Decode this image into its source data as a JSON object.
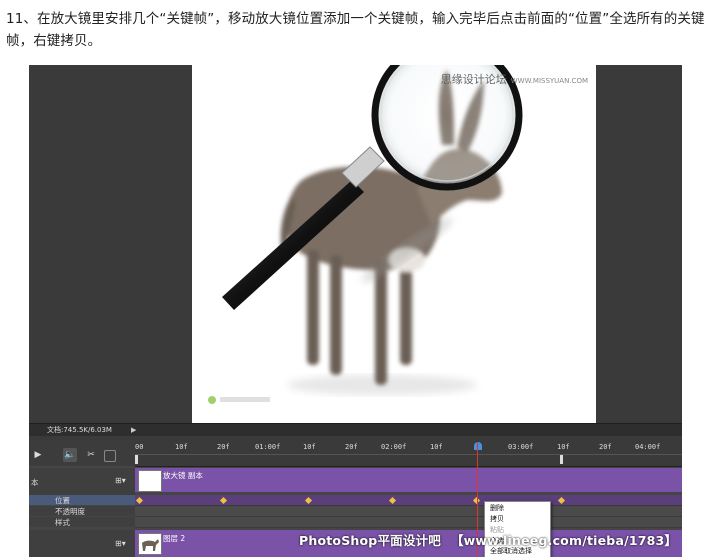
{
  "instruction": "11、在放大镜里安排几个“关键帧”，移动放大镜位置添加一个关键帧，输入完毕后点击前面的“位置”全选所有的关键帧，右键拷贝。",
  "watermark_top": {
    "cn": "思缘设计论坛",
    "url": "WWW.MISSYUAN.COM"
  },
  "statusbar": {
    "doc_size": "文档:745.5K/6.03M",
    "arrow": "▶"
  },
  "timeline": {
    "ticks": [
      "00",
      "10f",
      "20f",
      "01:00f",
      "10f",
      "20f",
      "02:00f",
      "10f",
      "20f",
      "03:00f",
      "10f",
      "20f",
      "04:00f"
    ],
    "layers": [
      {
        "label": "本",
        "clip": "放大镜 副本"
      },
      {
        "label": "图层 2",
        "clip": "图层 2"
      }
    ],
    "properties": [
      "位置",
      "不透明度",
      "样式"
    ],
    "icons": {
      "play": "▶",
      "audio": "🔈",
      "cut": "✂",
      "transition": "◪"
    }
  },
  "context_menu": {
    "items": [
      "删除",
      "拷贝",
      "粘贴",
      "全选",
      "全部取消选择"
    ]
  },
  "bottom_watermark": {
    "brand": "PhotoShop平面设计吧",
    "url": "【www.lineeg.com/tieba/1783】"
  },
  "colors": {
    "track": "#7a52a8",
    "keyframe": "#f0c040",
    "playhead": "#d33333"
  }
}
